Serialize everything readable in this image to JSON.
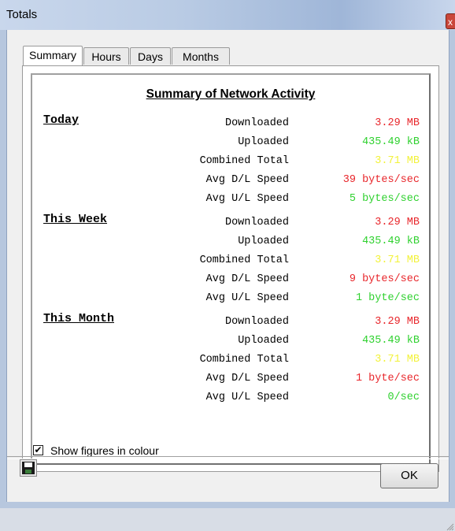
{
  "window": {
    "title": "Totals",
    "close_glyph": "x"
  },
  "tabs": [
    {
      "label": "Summary",
      "active": true
    },
    {
      "label": "Hours",
      "active": false
    },
    {
      "label": "Days",
      "active": false
    },
    {
      "label": "Months",
      "active": false
    }
  ],
  "summary": {
    "heading": "Summary of Network Activity",
    "labels": {
      "downloaded": "Downloaded",
      "uploaded": "Uploaded",
      "combined": "Combined Total",
      "avg_dl": "Avg D/L Speed",
      "avg_ul": "Avg U/L Speed"
    },
    "sections": [
      {
        "title": "Today",
        "downloaded": "3.29 MB",
        "uploaded": "435.49 kB",
        "combined": "3.71 MB",
        "avg_dl": "39 bytes/sec",
        "avg_ul": "5 bytes/sec"
      },
      {
        "title": "This Week",
        "downloaded": "3.29 MB",
        "uploaded": "435.49 kB",
        "combined": "3.71 MB",
        "avg_dl": "9 bytes/sec",
        "avg_ul": "1 byte/sec"
      },
      {
        "title": "This Month",
        "downloaded": "3.29 MB",
        "uploaded": "435.49 kB",
        "combined": "3.71 MB",
        "avg_dl": "1 byte/sec",
        "avg_ul": "0/sec"
      }
    ]
  },
  "options": {
    "show_colour_label": "Show figures in colour",
    "show_colour_checked": true,
    "check_glyph": "✔"
  },
  "buttons": {
    "ok_label": "OK",
    "save_icon": "floppy-disk-icon"
  },
  "colors": {
    "downloaded": "#e8262b",
    "uploaded": "#2fd12f",
    "combined": "#f2f23a",
    "avg_dl": "#e8262b",
    "avg_ul": "#2fd12f"
  }
}
